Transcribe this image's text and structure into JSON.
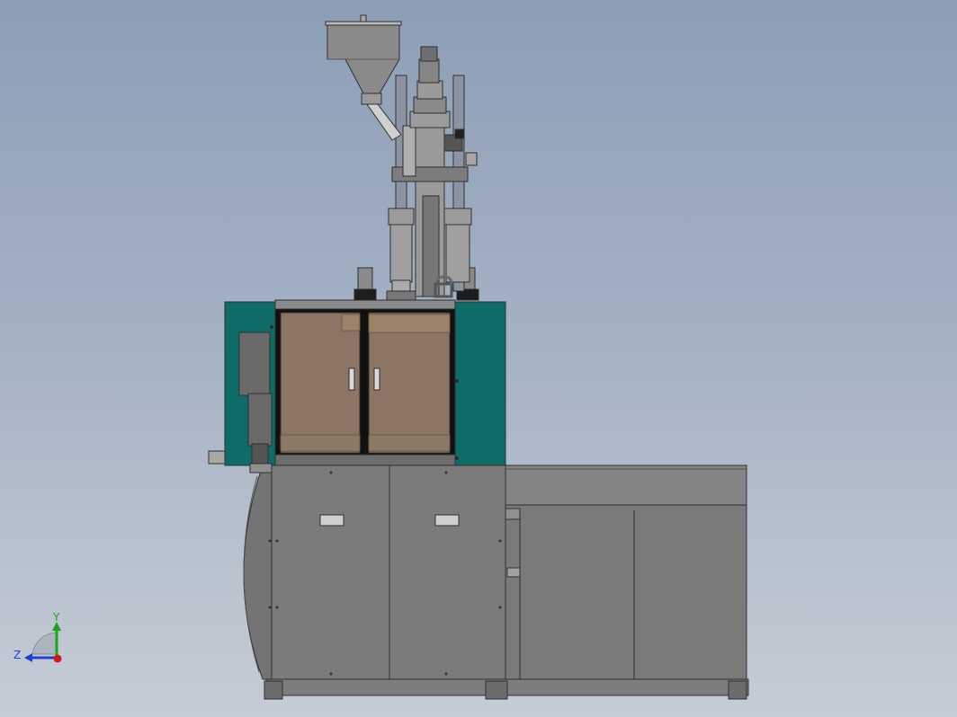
{
  "view": {
    "background_top": "#8c9eb6",
    "background_bottom": "#c6ccd6"
  },
  "model": {
    "frame_color": "#7b7b7b",
    "accent_color": "#0e6b68",
    "window_color": "#8c7565",
    "outline_color": "#303030"
  },
  "triad": {
    "y_label": "Y",
    "z_label": "Z",
    "y_color": "#1aa51a",
    "z_color": "#1f3fd0",
    "x_color": "#d01a1a"
  }
}
